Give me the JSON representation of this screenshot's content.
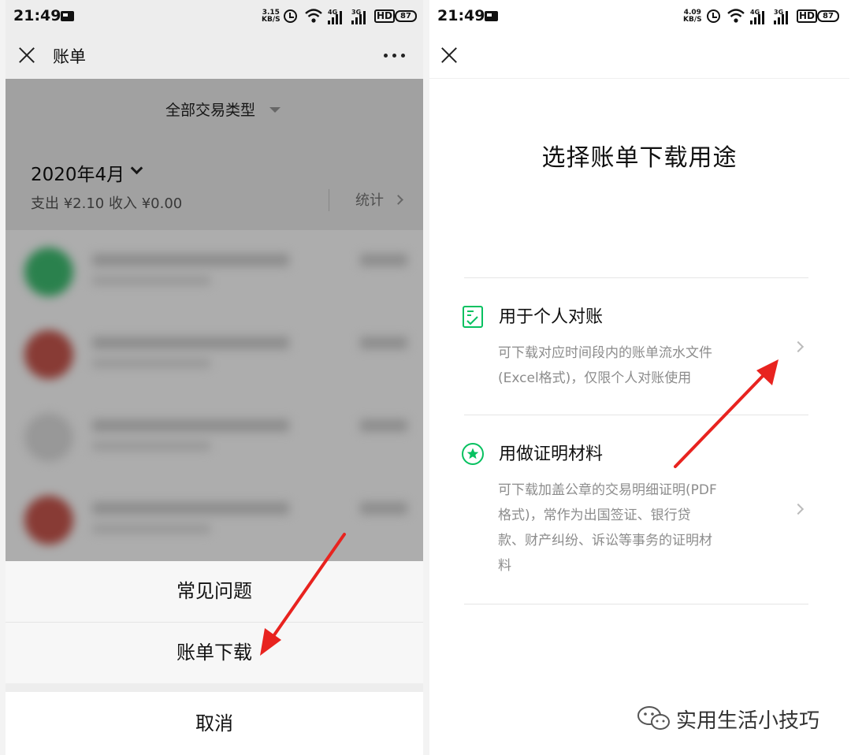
{
  "left": {
    "status": {
      "time": "21:49",
      "speed_value": "3.15",
      "speed_unit": "KB/S",
      "net1": "4G",
      "net2": "3G",
      "hd": "HD",
      "battery": "87"
    },
    "header": {
      "title": "账单"
    },
    "filter": {
      "label": "全部交易类型"
    },
    "month": {
      "label": "2020年4月",
      "summary": "支出 ¥2.10 收入 ¥0.00",
      "stats_link": "统计"
    },
    "action_sheet": {
      "items": [
        "常见问题",
        "账单下载"
      ],
      "cancel": "取消"
    }
  },
  "right": {
    "status": {
      "time": "21:49",
      "speed_value": "4.09",
      "speed_unit": "KB/S",
      "net1": "4G",
      "net2": "3G",
      "hd": "HD",
      "battery": "87"
    },
    "title": "选择账单下载用途",
    "options": [
      {
        "title": "用于个人对账",
        "desc_lines": [
          "可下载对应时间段内的账单流水文件",
          "(Excel格式)，仅限个人对账使用"
        ],
        "icon": "checklist-doc-icon"
      },
      {
        "title": "用做证明材料",
        "desc_lines": [
          "可下载加盖公章的交易明细证明(PDF",
          "格式)，常作为出国签证、银行贷",
          "款、财产纠纷、诉讼等事务的证明材",
          "料"
        ],
        "icon": "star-badge-icon"
      }
    ]
  },
  "watermark": {
    "text": "实用生活小技巧",
    "icon": "wechat-logo-icon"
  },
  "colors": {
    "wechat_green": "#07c160",
    "annotation_red": "#e8231f"
  }
}
